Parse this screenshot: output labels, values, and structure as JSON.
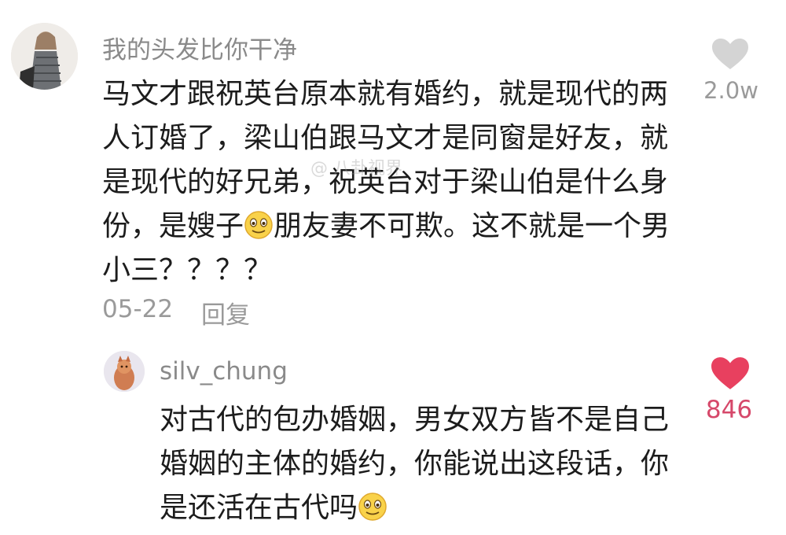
{
  "comment": {
    "username": "我的头发比你干净",
    "text_before_emoji": "马文才跟祝英台原本就有婚约，就是现代的两人订婚了，梁山伯跟马文才是同窗是好友，就是现代的好兄弟，祝英台对于梁山伯是什么身份，是嫂子",
    "text_after_emoji": "朋友妻不可欺。这不就是一个男小三？？？？",
    "date": "05-22",
    "reply_label": "回复",
    "likes": "2.0w",
    "liked": false
  },
  "reply": {
    "username": "silv_chung",
    "text_before_emoji": "对古代的包办婚姻，男女双方皆不是自己婚姻的主体的婚约，你能说出这段话，你是还活在古代吗",
    "likes": "846",
    "liked": true
  },
  "colors": {
    "like_active": "#e8405f",
    "like_inactive": "#d4d4d4",
    "meta_text": "#9a9a9a"
  },
  "icons": {
    "like": "heart-icon",
    "emoji": "smiling-face-emoji"
  }
}
